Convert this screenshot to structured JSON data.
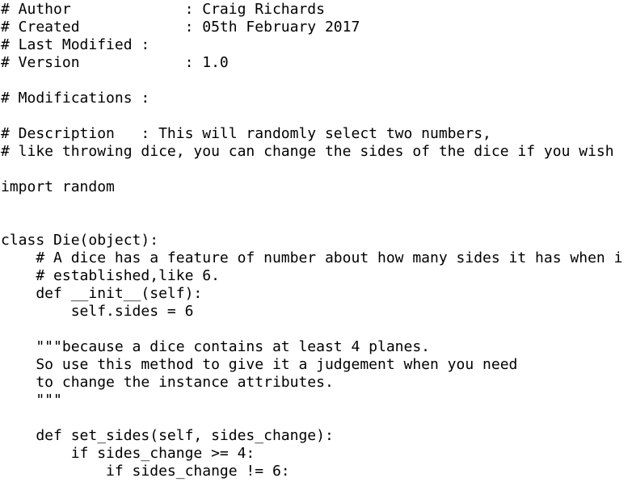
{
  "code": {
    "lines": [
      "# Author             : Craig Richards",
      "# Created            : 05th February 2017",
      "# Last Modified :",
      "# Version            : 1.0",
      "",
      "# Modifications :",
      "",
      "# Description   : This will randomly select two numbers,",
      "# like throwing dice, you can change the sides of the dice if you wish",
      "",
      "import random",
      "",
      "",
      "class Die(object):",
      "    # A dice has a feature of number about how many sides it has when i",
      "    # established,like 6.",
      "    def __init__(self):",
      "        self.sides = 6",
      "",
      "    \"\"\"because a dice contains at least 4 planes.",
      "    So use this method to give it a judgement when you need",
      "    to change the instance attributes.",
      "    \"\"\"",
      "",
      "    def set_sides(self, sides_change):",
      "        if sides_change >= 4:",
      "            if sides_change != 6:"
    ]
  }
}
